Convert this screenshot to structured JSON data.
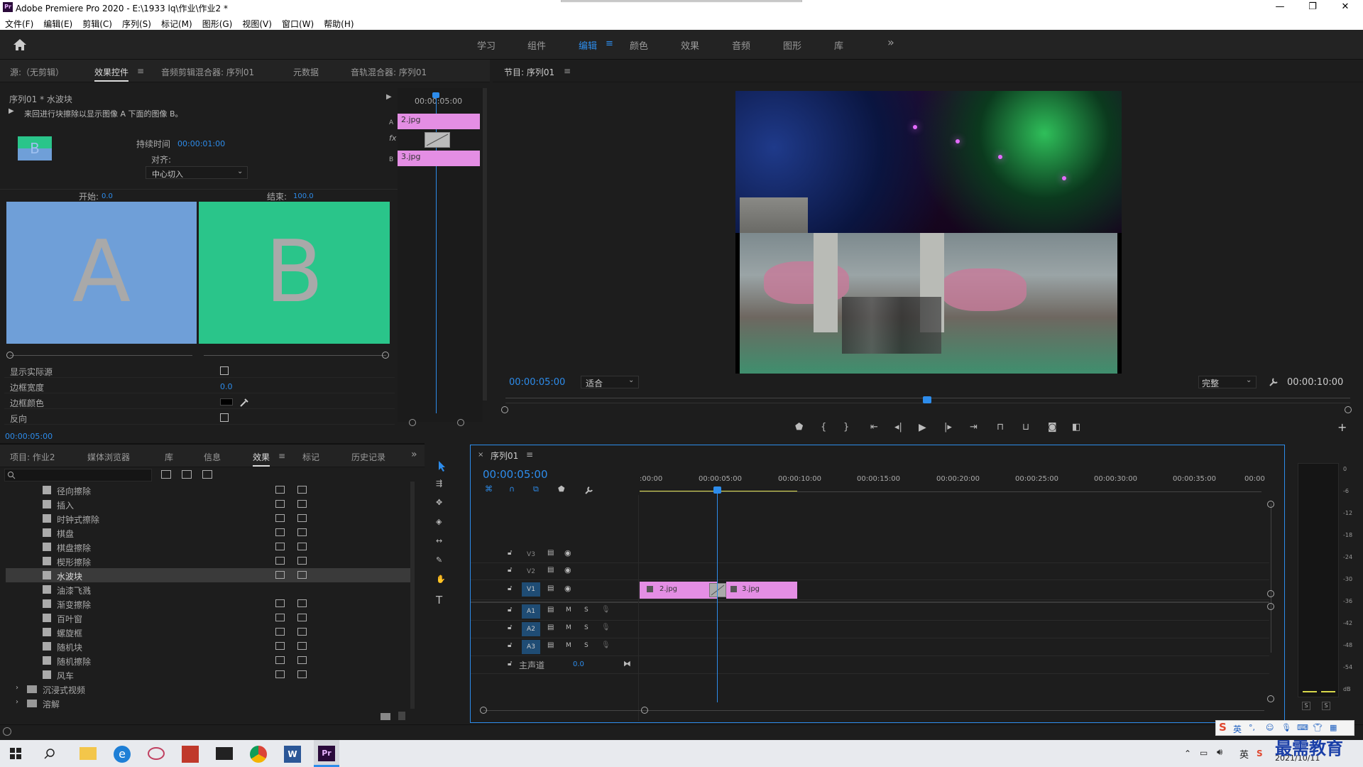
{
  "window": {
    "title": "Adobe Premiere Pro 2020 - E:\\1933 lq\\作业\\作业2 *",
    "app_icon": "Pr",
    "minimize": "—",
    "restore": "❐",
    "close": "✕"
  },
  "menu": [
    "文件(F)",
    "编辑(E)",
    "剪辑(C)",
    "序列(S)",
    "标记(M)",
    "图形(G)",
    "视图(V)",
    "窗口(W)",
    "帮助(H)"
  ],
  "workspaces": [
    "学习",
    "组件",
    "编辑",
    "颜色",
    "效果",
    "音频",
    "图形",
    "库"
  ],
  "workspace_active": "编辑",
  "workspace_more": "»",
  "source_panel": {
    "tabs": [
      "源:（无剪辑）",
      "效果控件",
      "音频剪辑混合器: 序列01",
      "元数据",
      "音轨混合器: 序列01"
    ],
    "active": "效果控件",
    "menu": "≡"
  },
  "effect_controls": {
    "clip": "序列01 * 水波块",
    "description": "来回进行块擦除以显示图像 A 下面的图像 B。",
    "duration_label": "持续时间",
    "duration": "00:00:01:00",
    "align_label": "对齐:",
    "align_value": "中心切入",
    "start_label": "开始:",
    "start_value": "0.0",
    "end_label": "结束:",
    "end_value": "100.0",
    "preview_a": "A",
    "preview_b": "B",
    "thumb_letter": "B",
    "props": [
      {
        "label": "显示实际源",
        "type": "checkbox"
      },
      {
        "label": "边框宽度",
        "value": "0.0"
      },
      {
        "label": "边框颜色",
        "type": "color"
      },
      {
        "label": "反向",
        "type": "checkbox"
      }
    ],
    "timecode": "00:00:05:00",
    "mini_timeline_tc": "00:00:05:00",
    "clip_a": "2.jpg",
    "clip_b": "3.jpg",
    "label_a": "A",
    "label_b": "B",
    "fx": "fx"
  },
  "program": {
    "title": "节目: 序列01",
    "menu": "≡",
    "timecode": "00:00:05:00",
    "fit": "适合",
    "quality": "完整",
    "duration": "00:00:10:00",
    "add": "+"
  },
  "project_panel": {
    "tabs": [
      "项目: 作业2",
      "媒体浏览器",
      "库",
      "信息",
      "效果",
      "标记",
      "历史记录"
    ],
    "active": "效果",
    "more": "»",
    "effects": [
      "径向擦除",
      "插入",
      "时钟式擦除",
      "棋盘",
      "棋盘擦除",
      "楔形擦除",
      "水波块",
      "油漆飞溅",
      "渐变擦除",
      "百叶窗",
      "螺旋框",
      "随机块",
      "随机擦除",
      "风车"
    ],
    "selected": "水波块",
    "no_badge": "油漆飞溅",
    "folders": [
      "沉浸式视频",
      "溶解"
    ]
  },
  "timeline": {
    "title": "序列01",
    "menu": "≡",
    "close": "×",
    "timecode": "00:00:05:00",
    "ruler": [
      ":00:00",
      "00:00:05:00",
      "00:00:10:00",
      "00:00:15:00",
      "00:00:20:00",
      "00:00:25:00",
      "00:00:30:00",
      "00:00:35:00",
      "00:00"
    ],
    "video_tracks": [
      "V3",
      "V2",
      "V1"
    ],
    "audio_tracks": [
      "A1",
      "A2",
      "A3"
    ],
    "m": "M",
    "s": "S",
    "master_label": "主声道",
    "master_value": "0.0",
    "clip1": "2.jpg",
    "clip2": "3.jpg"
  },
  "meter": {
    "marks": [
      "0",
      "-6",
      "-12",
      "-18",
      "-24",
      "-30",
      "-36",
      "-42",
      "-48",
      "-54",
      "dB"
    ],
    "solo": [
      "S",
      "S"
    ]
  },
  "taskbar": {
    "date": "2021/10/11",
    "ime": "英",
    "watermark": "最需教育"
  },
  "colors": {
    "accent": "#2d8ceb",
    "clip_pink": "#e48ee4",
    "preview_a": "#6f9fd8",
    "preview_b": "#2ac58a"
  }
}
